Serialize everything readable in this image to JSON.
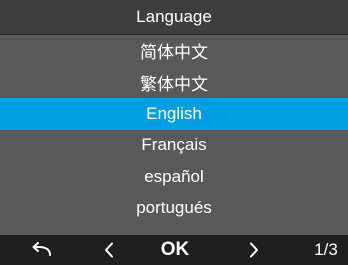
{
  "title": "Language",
  "languages": [
    {
      "label": "简体中文"
    },
    {
      "label": "繁体中文"
    },
    {
      "label": "English"
    },
    {
      "label": "Français"
    },
    {
      "label": "español"
    },
    {
      "label": "portugués"
    }
  ],
  "selected_index": 2,
  "bottom_bar": {
    "ok_label": "OK",
    "page": "1/3",
    "icons": {
      "back": "back-arrow-icon",
      "prev": "chevron-left-icon",
      "next": "chevron-right-icon"
    }
  },
  "colors": {
    "background": "#58595b",
    "title_bar": "#3d3e40",
    "selected": "#009ee3",
    "bottom_bar": "#1e1f20",
    "text": "#ffffff"
  }
}
